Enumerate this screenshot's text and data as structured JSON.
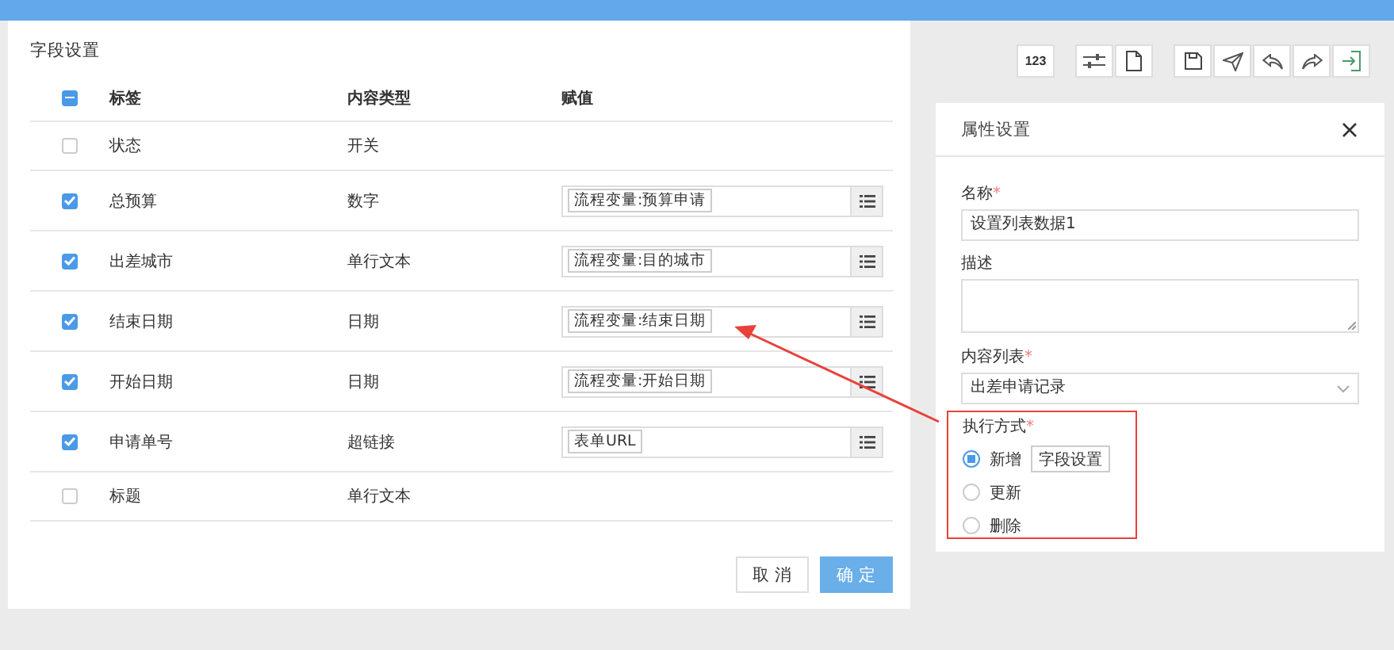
{
  "dialog": {
    "title": "字段设置",
    "header_checkbox": {
      "indeterminate": true
    },
    "columns": [
      "标签",
      "内容类型",
      "赋值"
    ],
    "rows": [
      {
        "label": "状态",
        "type": "开关",
        "checked": false
      },
      {
        "label": "总预算",
        "type": "数字",
        "checked": true,
        "value": "流程变量:预算申请"
      },
      {
        "label": "出差城市",
        "type": "单行文本",
        "checked": true,
        "value": "流程变量:目的城市"
      },
      {
        "label": "结束日期",
        "type": "日期",
        "checked": true,
        "value": "流程变量:结束日期"
      },
      {
        "label": "开始日期",
        "type": "日期",
        "checked": true,
        "value": "流程变量:开始日期"
      },
      {
        "label": "申请单号",
        "type": "超链接",
        "checked": true,
        "value": "表单URL"
      },
      {
        "label": "标题",
        "type": "单行文本",
        "checked": false
      }
    ],
    "buttons": [
      {
        "kind": "cancel",
        "label": "取 消"
      },
      {
        "kind": "ok",
        "label": "确 定"
      }
    ]
  },
  "toolbar": [
    [
      {
        "kind": "text",
        "label": "123"
      }
    ],
    [
      {
        "kind": "sliders"
      },
      {
        "kind": "file"
      }
    ],
    [
      {
        "kind": "save"
      },
      {
        "kind": "send"
      },
      {
        "kind": "undo"
      },
      {
        "kind": "redo"
      },
      {
        "kind": "exit"
      }
    ]
  ],
  "properties": {
    "title": "属性设置",
    "name": {
      "label": "名称",
      "required_mark": "*",
      "value": "设置列表数据1"
    },
    "description": {
      "label": "描述"
    },
    "content_list": {
      "label": "内容列表",
      "required_mark": "*",
      "value": "出差申请记录"
    },
    "execution": {
      "label": "执行方式",
      "required_mark": "*",
      "highlighted": true,
      "options": [
        {
          "label": "新增",
          "selected": true,
          "button": "字段设置"
        },
        {
          "label": "更新",
          "selected": false
        },
        {
          "label": "删除",
          "selected": false
        }
      ]
    }
  },
  "annotation": {
    "arrow": true
  }
}
